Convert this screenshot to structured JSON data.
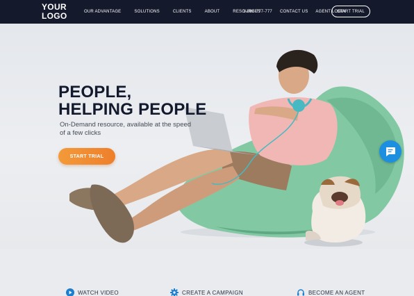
{
  "nav": {
    "logo_line1": "YOUR",
    "logo_line2": "LOGO",
    "links": [
      "OUR ADVANTAGE",
      "SOLUTIONS",
      "CLIENTS",
      "ABOUT",
      "RESOURCES"
    ],
    "phone": "1-888-777-777",
    "contact": "CONTACT US",
    "agent_login": "AGENT LOGIN",
    "cta": "START TRIAL"
  },
  "hero": {
    "headline_line1": "PEOPLE,",
    "headline_line2": "HELPING PEOPLE",
    "subline": "On-Demand resource, available at the speed of a few clicks",
    "cta": "START TRIAL",
    "chat_icon": "chat-bubble-icon"
  },
  "actions": [
    {
      "label": "WATCH VIDEO",
      "icon": "play-circle-icon"
    },
    {
      "label": "CREATE A CAMPAIGN",
      "icon": "gear-icon"
    },
    {
      "label": "BECOME AN AGENT",
      "icon": "headset-icon"
    }
  ],
  "colors": {
    "nav_bg": "#15192c",
    "accent_orange": "#ef842f",
    "chat_blue": "#1d8fe0",
    "icon_blue": "#1a7fd0",
    "beanbag_green": "#7fc7a0"
  }
}
